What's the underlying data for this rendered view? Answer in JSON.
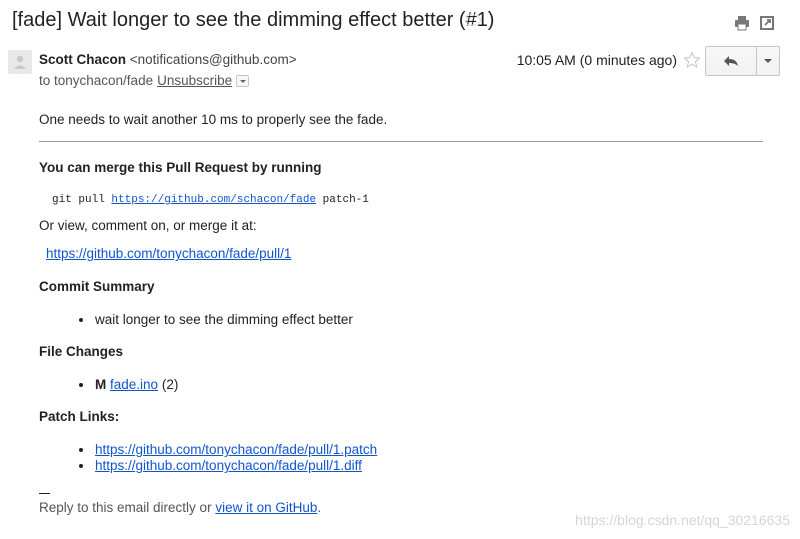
{
  "subject": "[fade] Wait longer to see the dimming effect better (#1)",
  "icons": {
    "print": "print-icon",
    "new_window": "new-window-icon",
    "label": "label-tag-icon",
    "avatar": "person-icon",
    "star": "star-icon",
    "reply": "reply-arrow-icon",
    "more": "chevron-down-icon"
  },
  "header": {
    "sender_name": "Scott Chacon",
    "sender_email": "<notifications@github.com>",
    "to": "to tonychacon/fade",
    "unsubscribe": "Unsubscribe",
    "timestamp": "10:05 AM (0 minutes ago)"
  },
  "message": {
    "intro": "One needs to wait another 10 ms to properly see the fade.",
    "merge_heading": "You can merge this Pull Request by running",
    "cmd_prefix": "git pull",
    "cmd_url": "https://github.com/schacon/fade",
    "cmd_suffix": "patch-1",
    "view_text": "Or view, comment on, or merge it at:",
    "pr_url": "https://github.com/tonychacon/fade/pull/1",
    "commit_heading": "Commit Summary",
    "commit_item": "wait longer to see the dimming effect better",
    "files_heading": "File Changes",
    "file_status": "M",
    "file_name": "fade.ino",
    "file_count": "(2)",
    "patch_heading": "Patch Links:",
    "patch_links": [
      "https://github.com/tonychacon/fade/pull/1.patch",
      "https://github.com/tonychacon/fade/pull/1.diff"
    ],
    "reply_prefix": "Reply to this email directly or",
    "reply_link": "view it on GitHub",
    "reply_suffix": "."
  },
  "watermark": "https://blog.csdn.net/qq_30216635",
  "colors": {
    "link": "#1155cc",
    "text": "#222222",
    "muted": "#555555"
  }
}
